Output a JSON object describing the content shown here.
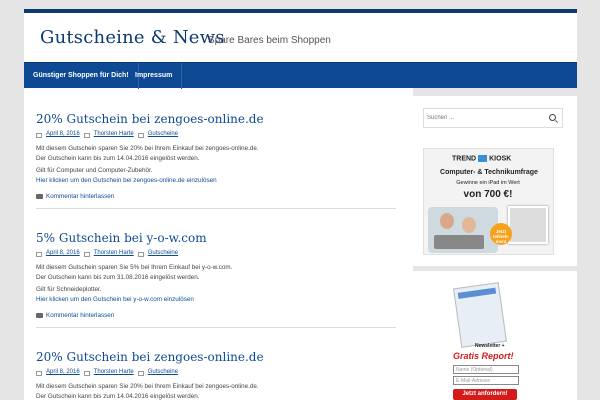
{
  "site": {
    "title": "Gutscheine & News",
    "description": "Spare Bares beim Shoppen"
  },
  "nav": {
    "items": [
      {
        "label": "Günstiger Shoppen für Dich!"
      },
      {
        "label": "Impressum"
      }
    ]
  },
  "posts": [
    {
      "title": "20% Gutschein bei zengoes-online.de",
      "date": "April 8, 2016",
      "author": "Thorsten Harte",
      "category": "Gutscheine",
      "line1": "Mit diesem Gutschein sparen Sie 20% bei Ihrem Einkauf bei zengoes-online.de.",
      "line2": "Der Gutschein kann bis zum 14.04.2016 eingelöst werden.",
      "valid": "Gilt für Computer und Computer-Zubehör.",
      "link": "Hier klicken um den Gutschein bei zengoes-online.de einzulösen",
      "comment": "Kommentar hinterlassen"
    },
    {
      "title": "5% Gutschein bei y-o-w.com",
      "date": "April 8, 2016",
      "author": "Thorsten Harte",
      "category": "Gutscheine",
      "line1": "Mit diesem Gutschein sparen Sie 5% bei Ihrem Einkauf bei y-o-w.com.",
      "line2": "Der Gutschein kann bis zum 31.08.2016 eingelöst werden.",
      "valid": "Gilt für Schneideplotter.",
      "link": "Hier klicken um den Gutschein bei y-o-w.com einzulösen",
      "comment": "Kommentar hinterlassen"
    },
    {
      "title": "20% Gutschein bei zengoes-online.de",
      "date": "April 8, 2016",
      "author": "Thorsten Harte",
      "category": "Gutscheine",
      "line1": "Mit diesem Gutschein sparen Sie 20% bei Ihrem Einkauf bei zengoes-online.de.",
      "line2": "Der Gutschein kann bis zum 14.04.2016 eingelöst werden."
    }
  ],
  "sidebar": {
    "search_placeholder": "Suchen ...",
    "ad": {
      "logo_left": "TREND",
      "logo_right": "KIOSK",
      "headline": "Computer- & Technikumfrage",
      "subline": "Gewinne ein iPad im Wert",
      "price": "von 700 €!",
      "badge": "Jetzt teilneh- men!"
    },
    "newsletter": {
      "label": "Newsletter +",
      "gratis": "Gratis Report!",
      "name_placeholder": "Name (Optional)",
      "email_placeholder": "E-Mail-Adresse",
      "button": "Jetzt anfordern!"
    }
  },
  "colors": {
    "brand": "#0d3a72",
    "nav": "#0d4a93",
    "link": "#0d4a93",
    "cta": "#d31b1b"
  }
}
